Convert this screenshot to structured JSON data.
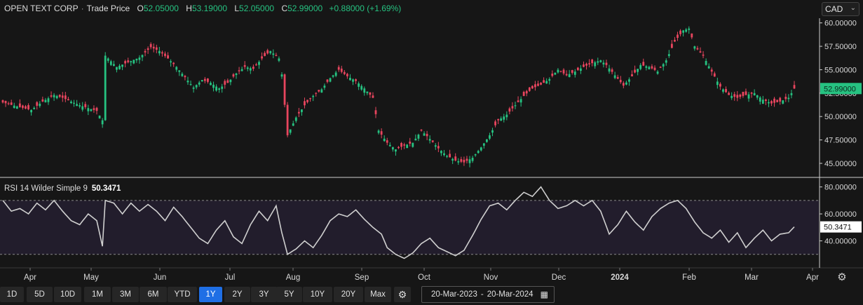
{
  "header": {
    "company": "OPEN TEXT CORP",
    "separator": "·",
    "price_type": "Trade Price",
    "open_label": "O",
    "open": "52.05000",
    "high_label": "H",
    "high": "53.19000",
    "low_label": "L",
    "low": "52.05000",
    "close_label": "C",
    "close": "52.99000",
    "change": "+0.88000 (+1.69%)"
  },
  "currency": {
    "value": "CAD",
    "arrow": "⌄"
  },
  "rsi_header": {
    "label": "RSI 14 Wilder Simple 9",
    "value": "50.3471"
  },
  "colors": {
    "up": "#26c281",
    "down": "#e8455e",
    "rsi_line": "#cfcfcf",
    "rsi_band": "#221d2c",
    "active": "#1f6fe5"
  },
  "toolbar": {
    "buttons": [
      "1D",
      "5D",
      "10D",
      "1M",
      "3M",
      "6M",
      "YTD",
      "1Y",
      "2Y",
      "3Y",
      "5Y",
      "10Y",
      "20Y",
      "Max"
    ],
    "active": "1Y",
    "settings_icon": "gear-icon",
    "date_from": "20-Mar-2023",
    "date_sep": "-",
    "date_to": "20-Mar-2024",
    "calendar_icon": "calendar-icon"
  },
  "chart_data": [
    {
      "type": "candlestick",
      "title": "OPEN TEXT CORP · Trade Price",
      "x_labels": [
        "Apr",
        "May",
        "Jun",
        "Jul",
        "Aug",
        "Sep",
        "Oct",
        "Nov",
        "Dec",
        "2024",
        "Feb",
        "Mar",
        "Apr"
      ],
      "ylim": [
        43.5,
        60.5
      ],
      "y_ticks": [
        "60.00000",
        "57.50000",
        "55.00000",
        "52.50000",
        "50.00000",
        "47.50000",
        "45.00000"
      ],
      "last_price_label": "52.99000",
      "close_path": [
        [
          0,
          51.5
        ],
        [
          6,
          51.0
        ],
        [
          10,
          50.7
        ],
        [
          14,
          51.6
        ],
        [
          18,
          52.3
        ],
        [
          21,
          52.0
        ],
        [
          24,
          51.6
        ],
        [
          27,
          51.2
        ],
        [
          30,
          50.9
        ],
        [
          33,
          50.6
        ],
        [
          35,
          49.6
        ],
        [
          36,
          56.5
        ],
        [
          40,
          55.3
        ],
        [
          44,
          55.8
        ],
        [
          48,
          56.3
        ],
        [
          52,
          57.4
        ],
        [
          55,
          57.0
        ],
        [
          58,
          56.2
        ],
        [
          61,
          55.3
        ],
        [
          64,
          54.2
        ],
        [
          67,
          53.1
        ],
        [
          70,
          53.9
        ],
        [
          73,
          53.6
        ],
        [
          76,
          53.0
        ],
        [
          79,
          53.6
        ],
        [
          82,
          54.6
        ],
        [
          85,
          55.3
        ],
        [
          88,
          55.1
        ],
        [
          91,
          56.2
        ],
        [
          94,
          57.0
        ],
        [
          97,
          56.2
        ],
        [
          98,
          54.5
        ],
        [
          100,
          48.0
        ],
        [
          103,
          49.9
        ],
        [
          106,
          51.2
        ],
        [
          109,
          52.2
        ],
        [
          112,
          52.9
        ],
        [
          115,
          54.1
        ],
        [
          118,
          55.0
        ],
        [
          121,
          54.3
        ],
        [
          124,
          53.8
        ],
        [
          127,
          53.0
        ],
        [
          130,
          52.0
        ],
        [
          132,
          48.5
        ],
        [
          135,
          47.2
        ],
        [
          138,
          46.5
        ],
        [
          141,
          46.9
        ],
        [
          144,
          47.2
        ],
        [
          147,
          48.5
        ],
        [
          150,
          47.6
        ],
        [
          153,
          46.6
        ],
        [
          156,
          45.8
        ],
        [
          159,
          45.3
        ],
        [
          162,
          45.1
        ],
        [
          165,
          45.6
        ],
        [
          168,
          46.7
        ],
        [
          171,
          48.0
        ],
        [
          174,
          49.6
        ],
        [
          177,
          50.2
        ],
        [
          180,
          51.2
        ],
        [
          183,
          52.2
        ],
        [
          186,
          53.0
        ],
        [
          189,
          53.4
        ],
        [
          192,
          54.0
        ],
        [
          195,
          55.0
        ],
        [
          198,
          54.4
        ],
        [
          201,
          54.8
        ],
        [
          204,
          55.3
        ],
        [
          207,
          55.7
        ],
        [
          210,
          56.0
        ],
        [
          212,
          55.5
        ],
        [
          215,
          54.4
        ],
        [
          218,
          53.3
        ],
        [
          221,
          54.3
        ],
        [
          224,
          55.5
        ],
        [
          227,
          55.3
        ],
        [
          230,
          54.8
        ],
        [
          233,
          56.0
        ],
        [
          236,
          58.0
        ],
        [
          239,
          59.2
        ],
        [
          241,
          59.4
        ],
        [
          243,
          57.5
        ],
        [
          246,
          56.5
        ],
        [
          249,
          54.8
        ],
        [
          252,
          53.2
        ],
        [
          255,
          52.3
        ],
        [
          258,
          52.0
        ],
        [
          261,
          52.3
        ],
        [
          264,
          52.5
        ],
        [
          267,
          51.8
        ],
        [
          270,
          51.4
        ],
        [
          273,
          51.6
        ],
        [
          276,
          52.0
        ],
        [
          278,
          52.99
        ]
      ],
      "rsi": {
        "ylim": [
          20,
          85
        ],
        "y_ticks": [
          "80.00000",
          "60.00000",
          "40.00000"
        ],
        "upper": 70,
        "lower": 30,
        "path": [
          [
            0,
            70.0
          ],
          [
            3,
            62.0
          ],
          [
            6,
            64.0
          ],
          [
            9,
            60.0
          ],
          [
            12,
            68.0
          ],
          [
            15,
            63.0
          ],
          [
            18,
            70.0
          ],
          [
            21,
            62.0
          ],
          [
            24,
            55.0
          ],
          [
            27,
            52.0
          ],
          [
            30,
            60.0
          ],
          [
            33,
            55.0
          ],
          [
            35,
            36.0
          ],
          [
            36,
            70.0
          ],
          [
            39,
            68.0
          ],
          [
            42,
            60.0
          ],
          [
            45,
            68.0
          ],
          [
            48,
            62.0
          ],
          [
            51,
            67.0
          ],
          [
            54,
            62.0
          ],
          [
            57,
            55.0
          ],
          [
            60,
            65.0
          ],
          [
            63,
            58.0
          ],
          [
            66,
            50.0
          ],
          [
            69,
            42.0
          ],
          [
            72,
            38.0
          ],
          [
            75,
            48.0
          ],
          [
            78,
            55.0
          ],
          [
            81,
            43.0
          ],
          [
            84,
            38.0
          ],
          [
            87,
            52.0
          ],
          [
            90,
            62.0
          ],
          [
            93,
            55.0
          ],
          [
            96,
            66.0
          ],
          [
            98,
            46.0
          ],
          [
            100,
            30.0
          ],
          [
            103,
            34.0
          ],
          [
            106,
            40.0
          ],
          [
            109,
            35.0
          ],
          [
            112,
            44.0
          ],
          [
            115,
            55.0
          ],
          [
            118,
            60.0
          ],
          [
            121,
            58.0
          ],
          [
            124,
            63.0
          ],
          [
            127,
            56.0
          ],
          [
            130,
            50.0
          ],
          [
            133,
            45.0
          ],
          [
            135,
            35.0
          ],
          [
            138,
            30.0
          ],
          [
            141,
            27.0
          ],
          [
            144,
            31.0
          ],
          [
            147,
            38.0
          ],
          [
            150,
            42.0
          ],
          [
            153,
            35.0
          ],
          [
            156,
            32.0
          ],
          [
            159,
            29.0
          ],
          [
            162,
            33.0
          ],
          [
            165,
            44.0
          ],
          [
            168,
            56.0
          ],
          [
            171,
            66.0
          ],
          [
            174,
            68.0
          ],
          [
            177,
            63.0
          ],
          [
            180,
            70.0
          ],
          [
            183,
            76.0
          ],
          [
            186,
            73.0
          ],
          [
            189,
            80.0
          ],
          [
            192,
            70.0
          ],
          [
            195,
            64.0
          ],
          [
            198,
            66.0
          ],
          [
            201,
            70.0
          ],
          [
            204,
            66.0
          ],
          [
            207,
            70.0
          ],
          [
            210,
            62.0
          ],
          [
            213,
            45.0
          ],
          [
            216,
            52.0
          ],
          [
            219,
            62.0
          ],
          [
            222,
            54.0
          ],
          [
            225,
            48.0
          ],
          [
            228,
            58.0
          ],
          [
            231,
            64.0
          ],
          [
            234,
            68.0
          ],
          [
            237,
            70.0
          ],
          [
            240,
            64.0
          ],
          [
            243,
            54.0
          ],
          [
            246,
            46.0
          ],
          [
            249,
            42.0
          ],
          [
            252,
            48.0
          ],
          [
            255,
            39.0
          ],
          [
            258,
            46.0
          ],
          [
            261,
            35.0
          ],
          [
            264,
            42.0
          ],
          [
            267,
            48.0
          ],
          [
            270,
            40.0
          ],
          [
            273,
            45.0
          ],
          [
            276,
            46.0
          ],
          [
            278,
            50.35
          ]
        ]
      }
    }
  ]
}
